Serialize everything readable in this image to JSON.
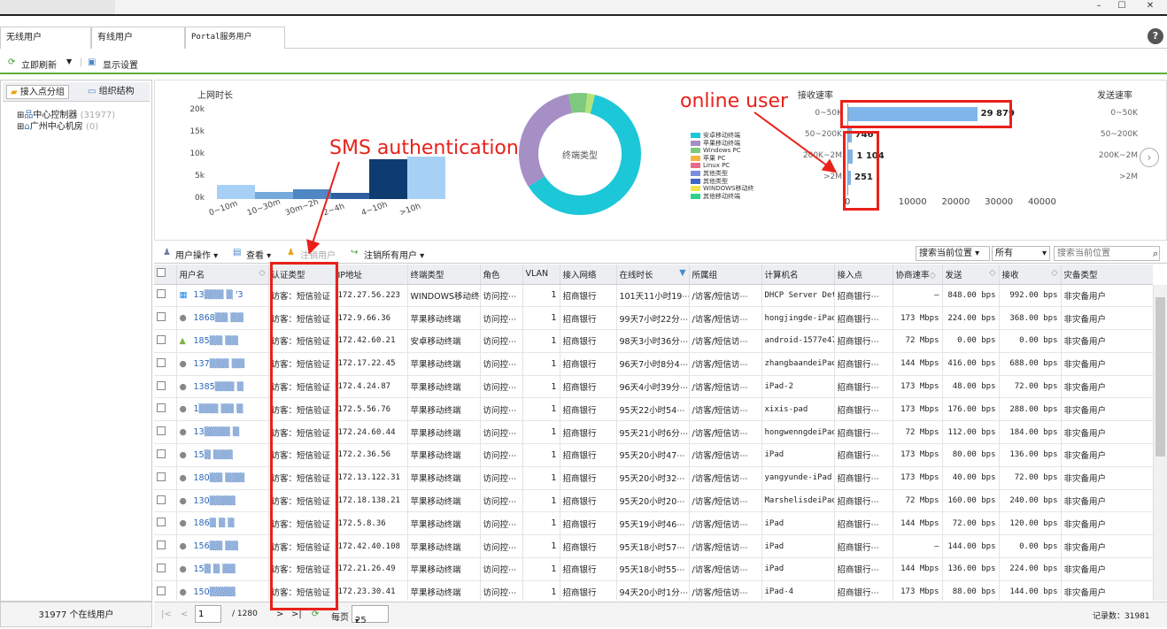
{
  "window": {
    "minimize": "–",
    "maximize": "☐",
    "close": "✕"
  },
  "tabs": [
    {
      "label": "无线用户"
    },
    {
      "label": "有线用户"
    },
    {
      "label": "Portal服务用户"
    }
  ],
  "help": "?",
  "toolbar": {
    "refresh": "立即刷新",
    "display_settings": "显示设置"
  },
  "left": {
    "tab_ap_group": "接入点分组",
    "tab_org": "组织结构",
    "tree": [
      {
        "label": "中心控制器",
        "count": "(31977)"
      },
      {
        "label": "广州中心机房",
        "count": "(0)"
      }
    ],
    "footer": "31977 个在线用户"
  },
  "charts": {
    "online_time": {
      "title": "上网时长",
      "yticks": [
        "20k",
        "15k",
        "10k",
        "5k",
        "0k"
      ],
      "categories": [
        "0~10m",
        "10~30m",
        "30m~2h",
        "2~4h",
        "4~10h",
        ">10h"
      ],
      "values": [
        3200,
        1600,
        2200,
        1500,
        9000,
        9600
      ],
      "colors": [
        "#a6d1f5",
        "#76a9dc",
        "#4f86c4",
        "#2e5f9e",
        "#0f3c70",
        "#a6d1f5"
      ]
    },
    "terminal_type": {
      "center_label": "终端类型",
      "legend": [
        "安卓移动终端",
        "苹果移动终端",
        "Windows PC",
        "苹果 PC",
        "Linux PC",
        "其他类型",
        "其他类型",
        "WINDOWS移动终",
        "其他移动终端"
      ],
      "legend_colors": [
        "#1cc7d8",
        "#a58fc5",
        "#7fc97f",
        "#f5b342",
        "#e86b8a",
        "#7b8fe0",
        "#3f66c7",
        "#f0e34a",
        "#2cd28a"
      ],
      "slices": [
        {
          "label": "安卓移动终端",
          "value": 62,
          "color": "#1cc7d8"
        },
        {
          "label": "苹果移动终端",
          "value": 31,
          "color": "#a58fc5"
        },
        {
          "label": "其他移动终端",
          "value": 5,
          "color": "#7fc97f"
        },
        {
          "label": "WINDOWS移动终",
          "value": 2,
          "color": "#b7e27a"
        }
      ]
    },
    "receive_rate": {
      "title": "接收速率",
      "categories": [
        "0~50K",
        "50~200K",
        "200K~2M",
        ">2M"
      ],
      "values": [
        29879,
        746,
        1104,
        251
      ],
      "value_labels": [
        "29 879",
        "746",
        "1 104",
        "251"
      ],
      "xticks": [
        "0",
        "10000",
        "20000",
        "30000",
        "40000"
      ],
      "xmax": 40000
    },
    "send_rate": {
      "title": "发送速率",
      "categories": [
        "0~50K",
        "50~200K",
        "200K~2M",
        ">2M"
      ]
    }
  },
  "grid_toolbar": {
    "user_ops": "用户操作",
    "view": "查看",
    "logout_user": "注销用户",
    "logout_all": "注销所有用户",
    "search_scope": "搜索当前位置",
    "filter": "所有",
    "search_placeholder": "搜索当前位置"
  },
  "table": {
    "headers": [
      "用户名",
      "认证类型",
      "IP地址",
      "终端类型",
      "角色",
      "VLAN",
      "接入网络",
      "在线时长",
      "所属组",
      "计算机名",
      "接入点",
      "协商速率",
      "发送",
      "接收",
      "灾备类型"
    ],
    "rows": [
      {
        "os": "windows",
        "user": "13▒▒▒ ▒ '3",
        "auth": "访客：短信验证",
        "ip": "172.27.56.223",
        "type": "WINDOWS移动终端",
        "role": "访问控⋯",
        "vlan": "1",
        "net": "招商银行",
        "time": "101天11小时19⋯",
        "group": "/访客/短信访⋯",
        "pc": "DHCP Server Det",
        "ap": "招商银行⋯",
        "rate": "–",
        "send": "848.00 bps",
        "recv": "992.00 bps",
        "dr": "非灾备用户"
      },
      {
        "os": "apple",
        "user": "1868▒▒ ▒▒",
        "auth": "访客：短信验证",
        "ip": "172.9.66.36",
        "type": "苹果移动终端",
        "role": "访问控⋯",
        "vlan": "1",
        "net": "招商银行",
        "time": "99天7小时22分⋯",
        "group": "/访客/短信访⋯",
        "pc": "hongjingde-iPad",
        "ap": "招商银行⋯",
        "rate": "173 Mbps",
        "send": "224.00 bps",
        "recv": "368.00 bps",
        "dr": "非灾备用户"
      },
      {
        "os": "android",
        "user": "185▒▒ ▒▒",
        "auth": "访客：短信验证",
        "ip": "172.42.60.21",
        "type": "安卓移动终端",
        "role": "访问控⋯",
        "vlan": "1",
        "net": "招商银行",
        "time": "98天3小时36分⋯",
        "group": "/访客/短信访⋯",
        "pc": "android-1577e47",
        "ap": "招商银行⋯",
        "rate": "72 Mbps",
        "send": "0.00 bps",
        "recv": "0.00 bps",
        "dr": "非灾备用户"
      },
      {
        "os": "apple",
        "user": "137▒▒▒ ▒▒",
        "auth": "访客：短信验证",
        "ip": "172.17.22.45",
        "type": "苹果移动终端",
        "role": "访问控⋯",
        "vlan": "1",
        "net": "招商银行",
        "time": "96天7小时8分4⋯",
        "group": "/访客/短信访⋯",
        "pc": "zhangbaandeiPad",
        "ap": "招商银行⋯",
        "rate": "144 Mbps",
        "send": "416.00 bps",
        "recv": "688.00 bps",
        "dr": "非灾备用户"
      },
      {
        "os": "apple",
        "user": "1385▒▒▒ ▒",
        "auth": "访客：短信验证",
        "ip": "172.4.24.87",
        "type": "苹果移动终端",
        "role": "访问控⋯",
        "vlan": "1",
        "net": "招商银行",
        "time": "96天4小时39分⋯",
        "group": "/访客/短信访⋯",
        "pc": "iPad-2",
        "ap": "招商银行⋯",
        "rate": "173 Mbps",
        "send": "48.00 bps",
        "recv": "72.00 bps",
        "dr": "非灾备用户"
      },
      {
        "os": "apple",
        "user": "1▒▒▒ ▒▒ ▒",
        "auth": "访客：短信验证",
        "ip": "172.5.56.76",
        "type": "苹果移动终端",
        "role": "访问控⋯",
        "vlan": "1",
        "net": "招商银行",
        "time": "95天22小时54⋯",
        "group": "/访客/短信访⋯",
        "pc": "xixis-pad",
        "ap": "招商银行⋯",
        "rate": "173 Mbps",
        "send": "176.00 bps",
        "recv": "288.00 bps",
        "dr": "非灾备用户"
      },
      {
        "os": "apple",
        "user": "13▒▒▒▒ ▒",
        "auth": "访客：短信验证",
        "ip": "172.24.60.44",
        "type": "苹果移动终端",
        "role": "访问控⋯",
        "vlan": "1",
        "net": "招商银行",
        "time": "95天21小时6分⋯",
        "group": "/访客/短信访⋯",
        "pc": "hongwenngdeiPad",
        "ap": "招商银行⋯",
        "rate": "72 Mbps",
        "send": "112.00 bps",
        "recv": "184.00 bps",
        "dr": "非灾备用户"
      },
      {
        "os": "apple",
        "user": "15▒ ▒▒▒",
        "auth": "访客：短信验证",
        "ip": "172.2.36.56",
        "type": "苹果移动终端",
        "role": "访问控⋯",
        "vlan": "1",
        "net": "招商银行",
        "time": "95天20小时47⋯",
        "group": "/访客/短信访⋯",
        "pc": "iPad",
        "ap": "招商银行⋯",
        "rate": "173 Mbps",
        "send": "80.00 bps",
        "recv": "136.00 bps",
        "dr": "非灾备用户"
      },
      {
        "os": "apple",
        "user": "180▒▒ ▒▒▒",
        "auth": "访客：短信验证",
        "ip": "172.13.122.31",
        "type": "苹果移动终端",
        "role": "访问控⋯",
        "vlan": "1",
        "net": "招商银行",
        "time": "95天20小时32⋯",
        "group": "/访客/短信访⋯",
        "pc": "yangyunde-iPad",
        "ap": "招商银行⋯",
        "rate": "173 Mbps",
        "send": "40.00 bps",
        "recv": "72.00 bps",
        "dr": "非灾备用户"
      },
      {
        "os": "apple",
        "user": "130▒▒▒▒",
        "auth": "访客：短信验证",
        "ip": "172.18.138.21",
        "type": "苹果移动终端",
        "role": "访问控⋯",
        "vlan": "1",
        "net": "招商银行",
        "time": "95天20小时20⋯",
        "group": "/访客/短信访⋯",
        "pc": "MarshelisdeiPad",
        "ap": "招商银行⋯",
        "rate": "72 Mbps",
        "send": "160.00 bps",
        "recv": "240.00 bps",
        "dr": "非灾备用户"
      },
      {
        "os": "apple",
        "user": "186▒ ▒ ▒",
        "auth": "访客：短信验证",
        "ip": "172.5.8.36",
        "type": "苹果移动终端",
        "role": "访问控⋯",
        "vlan": "1",
        "net": "招商银行",
        "time": "95天19小时46⋯",
        "group": "/访客/短信访⋯",
        "pc": "iPad",
        "ap": "招商银行⋯",
        "rate": "144 Mbps",
        "send": "72.00 bps",
        "recv": "120.00 bps",
        "dr": "非灾备用户"
      },
      {
        "os": "apple",
        "user": "156▒▒ ▒▒",
        "auth": "访客：短信验证",
        "ip": "172.42.40.108",
        "type": "苹果移动终端",
        "role": "访问控⋯",
        "vlan": "1",
        "net": "招商银行",
        "time": "95天18小时57⋯",
        "group": "/访客/短信访⋯",
        "pc": "iPad",
        "ap": "招商银行⋯",
        "rate": "–",
        "send": "144.00 bps",
        "recv": "0.00 bps",
        "dr": "非灾备用户"
      },
      {
        "os": "apple",
        "user": "15▒ ▒ ▒▒",
        "auth": "访客：短信验证",
        "ip": "172.21.26.49",
        "type": "苹果移动终端",
        "role": "访问控⋯",
        "vlan": "1",
        "net": "招商银行",
        "time": "95天18小时55⋯",
        "group": "/访客/短信访⋯",
        "pc": "iPad",
        "ap": "招商银行⋯",
        "rate": "144 Mbps",
        "send": "136.00 bps",
        "recv": "224.00 bps",
        "dr": "非灾备用户"
      },
      {
        "os": "apple",
        "user": "150▒▒▒▒",
        "auth": "访客：短信验证",
        "ip": "172.23.30.41",
        "type": "苹果移动终端",
        "role": "访问控⋯",
        "vlan": "1",
        "net": "招商银行",
        "time": "94天20小时1分⋯",
        "group": "/访客/短信访⋯",
        "pc": "iPad-4",
        "ap": "招商银行⋯",
        "rate": "173 Mbps",
        "send": "88.00 bps",
        "recv": "144.00 bps",
        "dr": "非灾备用户"
      }
    ]
  },
  "pager": {
    "page": "1",
    "total_pages": "/ 1280",
    "per_page_label": "每页",
    "per_page": "25",
    "record_count": "记录数：31981"
  },
  "annotations": {
    "sms": "SMS authentication",
    "online": "online user"
  }
}
